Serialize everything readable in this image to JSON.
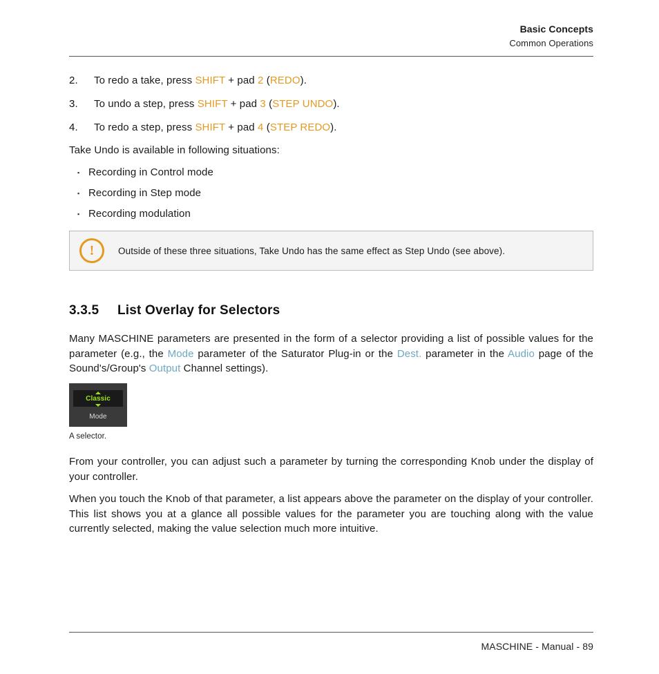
{
  "header": {
    "title": "Basic Concepts",
    "subtitle": "Common Operations"
  },
  "steps": [
    {
      "num": "2.",
      "pre": "To redo a take, press ",
      "k1": "SHIFT",
      "mid1": " + pad ",
      "k2": "2",
      "mid2": " (",
      "k3": "REDO",
      "post": ")."
    },
    {
      "num": "3.",
      "pre": "To undo a step, press ",
      "k1": "SHIFT",
      "mid1": " + pad ",
      "k2": "3",
      "mid2": " (",
      "k3": "STEP UNDO",
      "post": ")."
    },
    {
      "num": "4.",
      "pre": "To redo a step, press ",
      "k1": "SHIFT",
      "mid1": " + pad ",
      "k2": "4",
      "mid2": " (",
      "k3": "STEP REDO",
      "post": ")."
    }
  ],
  "p_take_undo": "Take Undo is available in following situations:",
  "bullets": [
    "Recording in Control mode",
    "Recording in Step mode",
    "Recording modulation"
  ],
  "note": "Outside of these three situations, Take Undo has the same effect as Step Undo (see above).",
  "section": {
    "num": "3.3.5",
    "title": "List Overlay for Selectors"
  },
  "para1": {
    "a": "Many MASCHINE parameters are presented in the form of a selector providing a list of possible values for the parameter (e.g., the ",
    "l1": "Mode",
    "b": " parameter of the Saturator Plug-in or the ",
    "l2": "Dest.",
    "c": " parameter in the ",
    "l3": "Audio",
    "d": " page of the Sound's/Group's ",
    "l4": "Output",
    "e": " Channel settings)."
  },
  "selector": {
    "value": "Classic",
    "label": "Mode"
  },
  "caption": "A selector.",
  "para2": "From your controller, you can adjust such a parameter by turning the corresponding Knob under the display of your controller.",
  "para3": "When you touch the Knob of that parameter, a list appears above the parameter on the display of your controller. This list shows you at a glance all possible values for the parameter you are touching along with the value currently selected, making the value selection much more intuitive.",
  "footer": "MASCHINE - Manual - 89"
}
